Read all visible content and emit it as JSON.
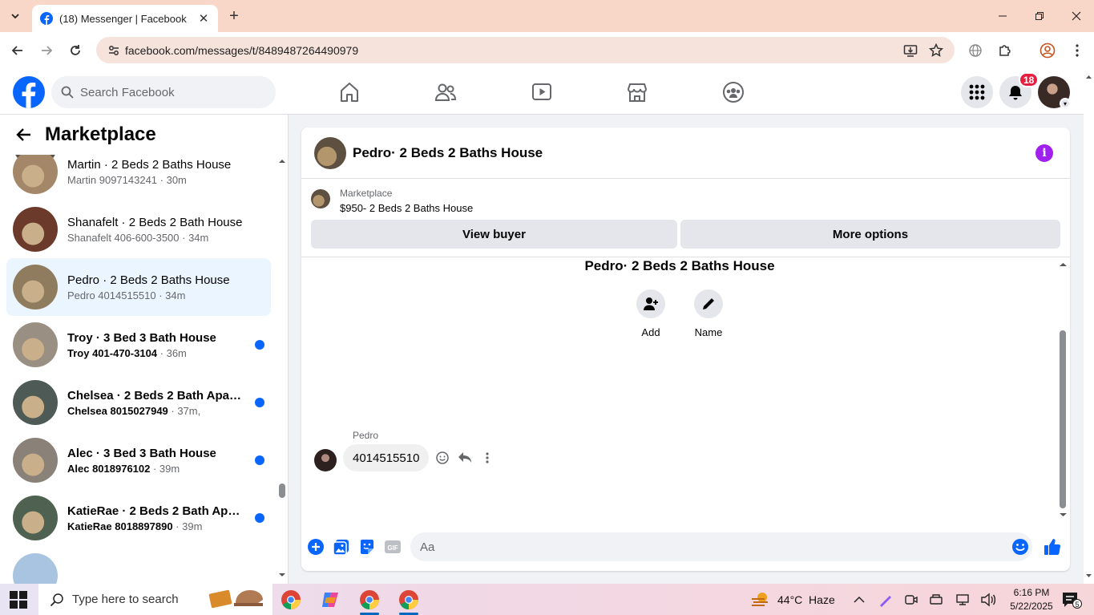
{
  "browser": {
    "tab_title": "(18) Messenger | Facebook",
    "url": "facebook.com/messages/t/8489487264490979"
  },
  "fb": {
    "search_placeholder": "Search Facebook",
    "notification_count": "18"
  },
  "left": {
    "title": "Marketplace",
    "chats": [
      {
        "name": "Martin · 2 Beds 2 Baths House",
        "phone": "Martin 9097143241",
        "time": " · 30m",
        "unread": false,
        "active": false,
        "avatar": "#a48768"
      },
      {
        "name": "Shanafelt · 2 Beds 2 Bath House",
        "phone": "Shanafelt 406-600-3500",
        "time": " · 34m",
        "unread": false,
        "active": false,
        "avatar": "#6b3a2a"
      },
      {
        "name": "Pedro · 2 Beds 2 Baths House",
        "phone": "Pedro 4014515510",
        "time": " · 34m",
        "unread": false,
        "active": true,
        "avatar": "#8f7c5e"
      },
      {
        "name": "Troy · 3 Bed 3 Bath House",
        "phone": "Troy 401-470-3104",
        "time": " · 36m",
        "unread": true,
        "active": false,
        "avatar": "#9a8f83"
      },
      {
        "name": "Chelsea · 2 Beds 2 Bath Apart...",
        "phone": "Chelsea 8015027949",
        "time": " · 37m,",
        "unread": true,
        "active": false,
        "avatar": "#4e5a55"
      },
      {
        "name": "Alec · 3 Bed 3 Bath House",
        "phone": "Alec 8018976102",
        "time": " · 39m",
        "unread": true,
        "active": false,
        "avatar": "#8a8278"
      },
      {
        "name": "KatieRae · 2 Beds 2 Bath Apart...",
        "phone": "KatieRae 8018897890",
        "time": " · 39m",
        "unread": true,
        "active": false,
        "avatar": "#4f6150"
      }
    ]
  },
  "chat": {
    "header_title": "Pedro· 2 Beds 2 Baths House",
    "marketplace_label": "Marketplace",
    "listing": "$950- 2 Beds 2 Baths House",
    "view_buyer": "View buyer",
    "more_options": "More options",
    "conversation_title": "Pedro· 2 Beds 2 Baths House",
    "add_label": "Add",
    "name_label": "Name",
    "sender": "Pedro",
    "message": "4014515510",
    "composer_placeholder": "Aa"
  },
  "taskbar": {
    "search_placeholder": "Type here to search",
    "weather": "44°C  Haze",
    "time": "6:16 PM",
    "date": "5/22/2025",
    "notif_count": "5"
  },
  "colors": {
    "fb_blue": "#0866ff",
    "unread_dot": "#0866ff",
    "active_chat_bg": "#ebf5ff",
    "info_purple": "#a020f0"
  }
}
